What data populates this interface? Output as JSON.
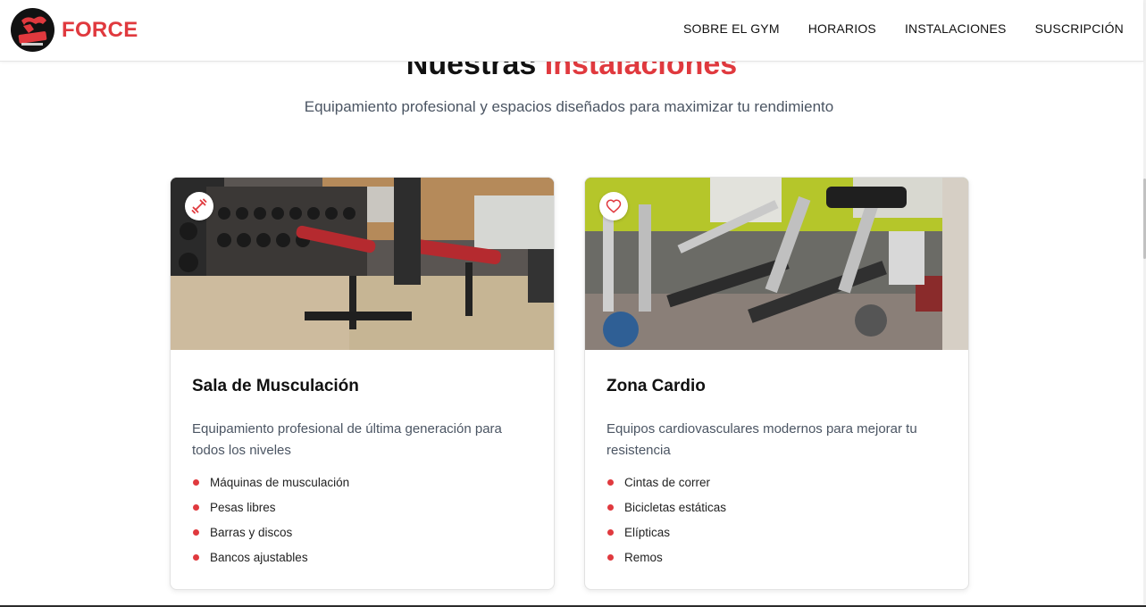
{
  "header": {
    "brand": "FORCE",
    "nav": [
      "SOBRE EL GYM",
      "HORARIOS",
      "INSTALACIONES",
      "SUSCRIPCIÓN"
    ]
  },
  "section": {
    "title_part1": "Nuestras ",
    "title_part2": "Instalaciones",
    "subtitle": "Equipamiento profesional y espacios diseñados para maximizar tu rendimiento"
  },
  "cards": [
    {
      "title": "Sala de Musculación",
      "description": "Equipamiento profesional de última generación para todos los niveles",
      "icon": "dumbbell-icon",
      "features": [
        "Máquinas de musculación",
        "Pesas libres",
        "Barras y discos",
        "Bancos ajustables"
      ]
    },
    {
      "title": "Zona Cardio",
      "description": "Equipos cardiovasculares modernos para mejorar tu resistencia",
      "icon": "heart-icon",
      "features": [
        "Cintas de correr",
        "Bicicletas estáticas",
        "Elípticas",
        "Remos"
      ]
    }
  ],
  "colors": {
    "accent": "#e0393e",
    "text": "#111111",
    "muted": "#4b5563"
  }
}
